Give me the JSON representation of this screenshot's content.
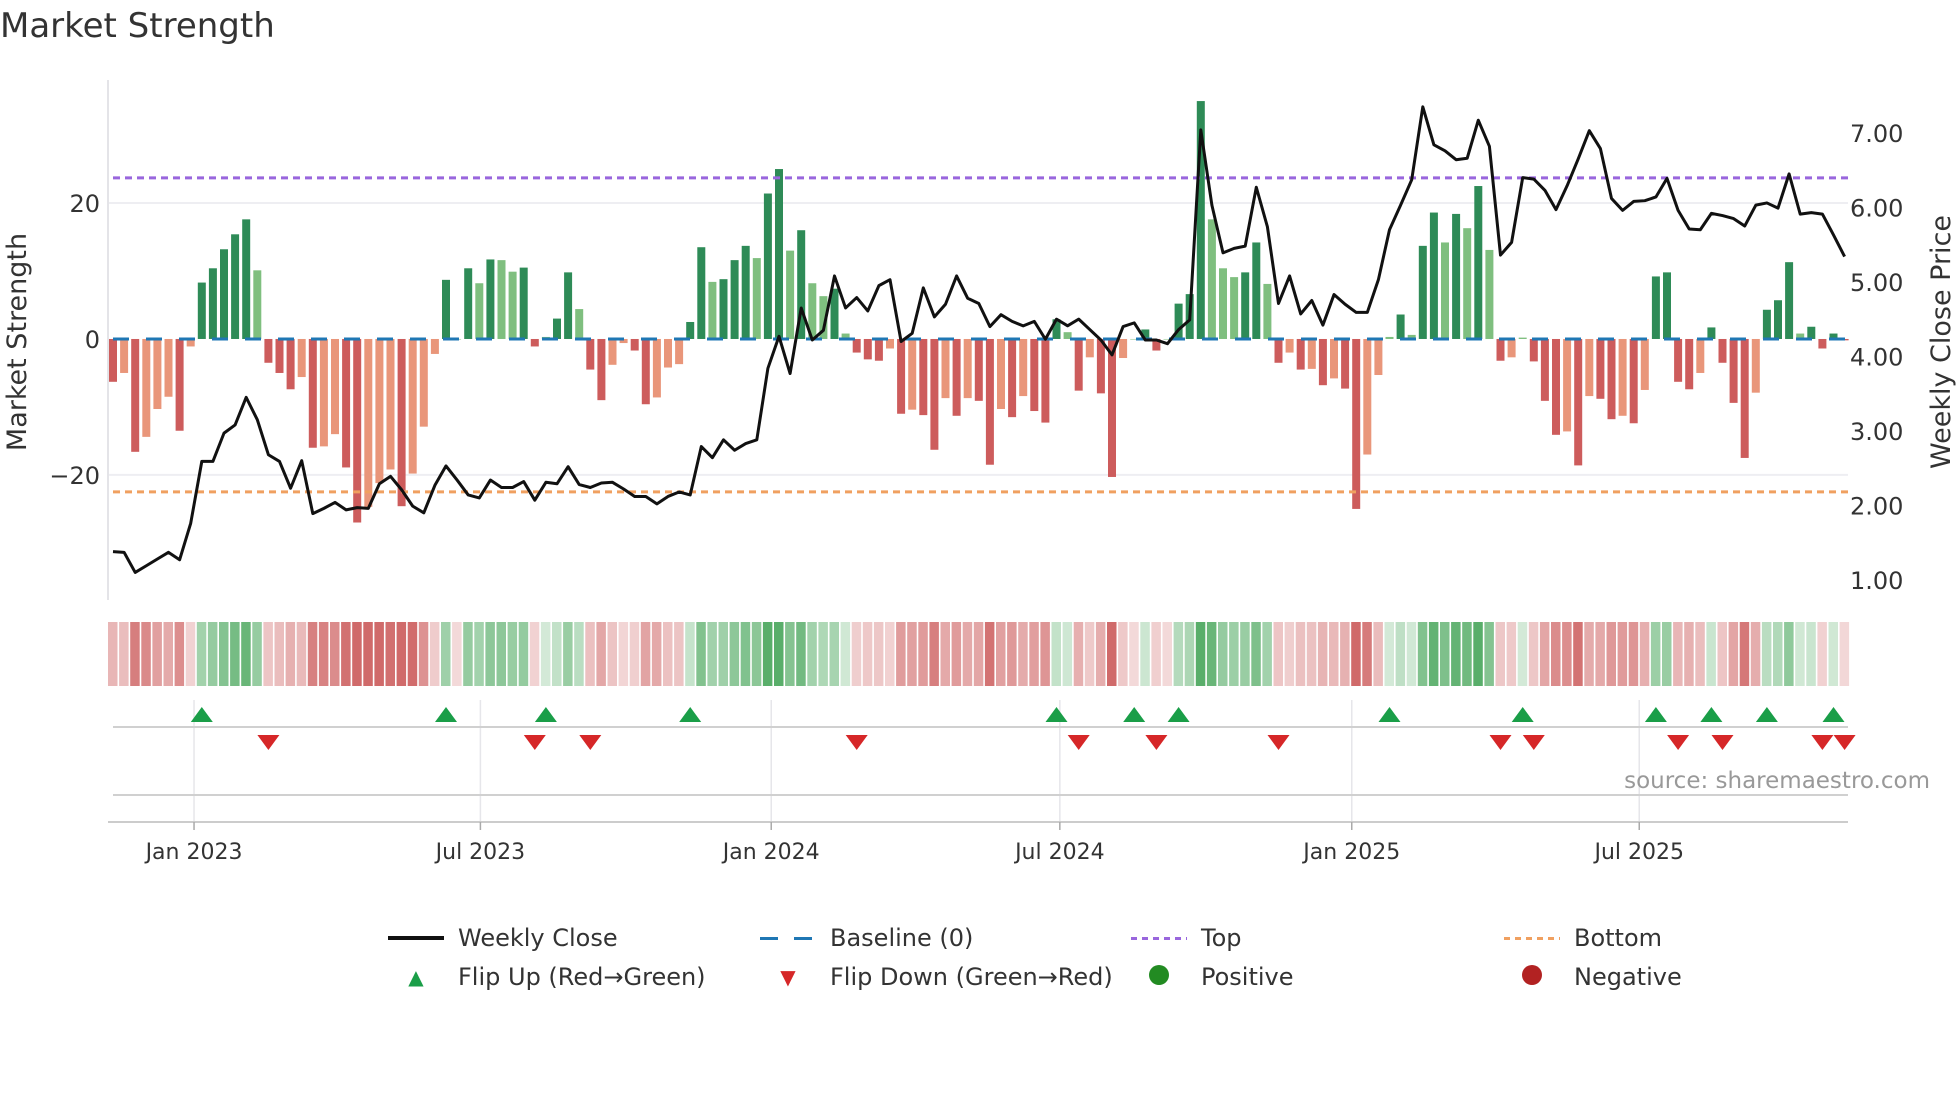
{
  "title": "Market Strength",
  "source": "source: sharemaestro.com",
  "legend": {
    "weekly_close": "Weekly Close",
    "baseline": "Baseline (0)",
    "top": "Top",
    "bottom": "Bottom",
    "flip_up": "Flip Up (Red→Green)",
    "flip_down": "Flip Down (Green→Red)",
    "positive": "Positive",
    "negative": "Negative"
  },
  "colors": {
    "dark_green": "#2e8b57",
    "light_green": "#7fbf7f",
    "red": "#cd5c5c",
    "salmon": "#e9967a",
    "line": "#111111",
    "baseline": "#1f77b4",
    "top": "#9966dd",
    "bottom": "#f0a060",
    "flip_up": "#1a9e48",
    "flip_down": "#d62728",
    "positive": "#228b22",
    "negative": "#b22222"
  },
  "chart_data": {
    "type": "bar",
    "title": "Market Strength",
    "ylabel": "Market Strength",
    "y2label": "Weekly Close Price",
    "ylim": [
      -38.4,
      38.1
    ],
    "y2lim": [
      0.73,
      7.71
    ],
    "yticks": [
      {
        "v": 20,
        "label": "20"
      },
      {
        "v": 0,
        "label": "0"
      },
      {
        "v": -20,
        "label": "−20"
      }
    ],
    "y2ticks": [
      {
        "v": 1,
        "label": "1.00"
      },
      {
        "v": 2,
        "label": "2.00"
      },
      {
        "v": 3,
        "label": "3.00"
      },
      {
        "v": 4,
        "label": "4.00"
      },
      {
        "v": 5,
        "label": "5.00"
      },
      {
        "v": 6,
        "label": "6.00"
      },
      {
        "v": 7,
        "label": "7.00"
      }
    ],
    "xticks": [
      {
        "week": 7.3,
        "label": "Jan 2023"
      },
      {
        "week": 33.1,
        "label": "Jul 2023"
      },
      {
        "week": 59.3,
        "label": "Jan 2024"
      },
      {
        "week": 85.3,
        "label": "Jul 2024"
      },
      {
        "week": 111.6,
        "label": "Jan 2025"
      },
      {
        "week": 137.5,
        "label": "Jul 2025"
      }
    ],
    "top_level": 23.7,
    "bottom_level": -22.5,
    "strength": [
      -6.3,
      -5,
      -16.6,
      -14.4,
      -10.3,
      -8.5,
      -13.5,
      -1.1,
      8.3,
      10.4,
      13.2,
      15.4,
      17.6,
      10.1,
      -3.5,
      -5,
      -7.4,
      -5.6,
      -16,
      -15.8,
      -14,
      -18.9,
      -27,
      -24.7,
      -21.2,
      -19.2,
      -24.6,
      -19.8,
      -12.9,
      -2.2,
      8.7,
      0,
      10.4,
      8.2,
      11.7,
      11.6,
      9.9,
      10.5,
      -1.1,
      0.3,
      3,
      9.8,
      4.4,
      -4.5,
      -9,
      -3.8,
      -0.6,
      -1.7,
      -9.6,
      -8.6,
      -4.2,
      -3.7,
      2.5,
      13.5,
      8.4,
      8.8,
      11.6,
      13.7,
      11.9,
      21.4,
      25,
      13,
      16,
      8.2,
      6.3,
      7.4,
      0.8,
      -2,
      -3,
      -3.2,
      -1.4,
      -11,
      -10.4,
      -11.2,
      -16.3,
      -8.7,
      -11.3,
      -8.7,
      -9.1,
      -18.5,
      -10.3,
      -11.5,
      -8.4,
      -10.6,
      -12.3,
      2.9,
      1,
      -7.6,
      -2.7,
      -8,
      -20.3,
      -2.8,
      0,
      1.4,
      -1.7,
      0,
      5.2,
      6.6,
      35,
      17.6,
      10.4,
      9.1,
      9.8,
      14.2,
      8.1,
      -3.5,
      -2,
      -4.5,
      -4.4,
      -6.8,
      -5.8,
      -7.3,
      -25,
      -17,
      -5.3,
      0.3,
      3.6,
      0.6,
      13.7,
      18.6,
      14.2,
      18.4,
      16.3,
      22.5,
      13.1,
      -3.2,
      -2.7,
      0.2,
      -3.3,
      -9.1,
      -14.1,
      -13.6,
      -18.6,
      -8.4,
      -8.8,
      -11.8,
      -11.3,
      -12.4,
      -7.5,
      9.2,
      9.8,
      -6.3,
      -7.4,
      -5,
      1.7,
      -3.5,
      -9.4,
      -17.5,
      -7.9,
      4.3,
      5.7,
      11.3,
      0.8,
      1.8,
      -1.4,
      0.8,
      -0.2
    ],
    "shade": "RSRSSSRSDDDDDLRRRSRSSRRSSSRSSSD-DLDLLDRLDDLRRSSRRSSSDDLDDDLDDLDLLDLRRRSRSRRSRSRRSRSRRDLRSRRS-DR-DDDLLLDDLRSRSRSRRSSLDLDDLDLDLRSLRRRSRSRRSRSDDRRSDRRRSDDDLDRDR",
    "weekly_close": [
      1.38,
      1.37,
      1.1,
      1.19,
      1.28,
      1.37,
      1.27,
      1.76,
      2.59,
      2.59,
      2.97,
      3.08,
      3.45,
      3.15,
      2.68,
      2.59,
      2.23,
      2.6,
      1.89,
      1.96,
      2.04,
      1.94,
      1.97,
      1.96,
      2.29,
      2.39,
      2.21,
      1.99,
      1.9,
      2.27,
      2.53,
      2.34,
      2.14,
      2.1,
      2.34,
      2.24,
      2.24,
      2.32,
      2.07,
      2.31,
      2.29,
      2.52,
      2.28,
      2.24,
      2.3,
      2.31,
      2.22,
      2.12,
      2.12,
      2.02,
      2.12,
      2.18,
      2.14,
      2.79,
      2.64,
      2.88,
      2.74,
      2.83,
      2.88,
      3.84,
      4.27,
      3.77,
      4.65,
      4.22,
      4.35,
      5.08,
      4.65,
      4.79,
      4.61,
      4.95,
      5.03,
      4.2,
      4.31,
      4.92,
      4.53,
      4.7,
      5.08,
      4.78,
      4.71,
      4.4,
      4.56,
      4.47,
      4.41,
      4.47,
      4.23,
      4.5,
      4.41,
      4.5,
      4.36,
      4.22,
      4.02,
      4.4,
      4.45,
      4.22,
      4.22,
      4.17,
      4.36,
      4.49,
      7.04,
      6.03,
      5.39,
      5.45,
      5.48,
      6.27,
      5.74,
      4.71,
      5.08,
      4.57,
      4.75,
      4.42,
      4.83,
      4.7,
      4.59,
      4.59,
      5.03,
      5.7,
      6.03,
      6.37,
      7.35,
      6.84,
      6.76,
      6.64,
      6.66,
      7.17,
      6.82,
      5.36,
      5.53,
      6.4,
      6.38,
      6.23,
      5.97,
      6.29,
      6.65,
      7.03,
      6.79,
      6.12,
      5.96,
      6.08,
      6.09,
      6.14,
      6.39,
      5.96,
      5.71,
      5.7,
      5.92,
      5.89,
      5.85,
      5.75,
      6.03,
      6.06,
      5.99,
      6.45,
      5.91,
      5.93,
      5.91,
      5.63,
      5.34
    ],
    "flip_up_weeks": [
      8,
      30,
      39,
      52,
      85,
      92,
      96,
      115,
      127,
      139,
      144,
      149,
      155
    ],
    "flip_down_weeks": [
      14,
      38,
      43,
      67,
      87,
      94,
      105,
      125,
      128,
      141,
      145,
      154,
      156
    ]
  }
}
